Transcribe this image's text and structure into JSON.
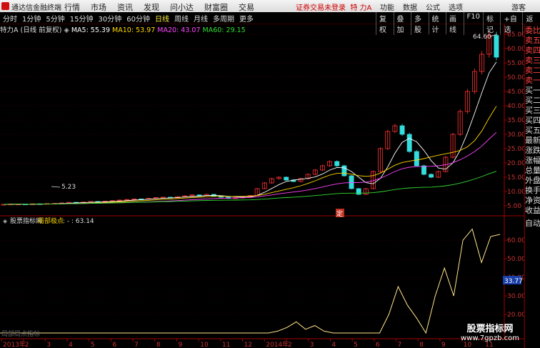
{
  "menubar": {
    "app_title": "通达信金融终端",
    "menus": [
      "行情",
      "市场",
      "资讯",
      "发现",
      "问小达",
      "财富圈",
      "交易"
    ],
    "notice": "证券交易未登录",
    "stock_name": "特 力A",
    "right_items": [
      "功能",
      "数据",
      "公式",
      "选项"
    ],
    "user": "游客",
    "accent": "#d01010"
  },
  "toolbar": {
    "periods": [
      "分时",
      "1分钟",
      "5分钟",
      "15分钟",
      "30分钟",
      "60分钟",
      "日线",
      "周线",
      "月线",
      "多周期",
      "更多"
    ],
    "active_period": "日线",
    "tools": [
      "复权",
      "叠加",
      "多股",
      "统计",
      "画线",
      "F10",
      "标记",
      "+自选",
      "返回"
    ]
  },
  "main_header": {
    "stock": "特力A",
    "mode": "(日线 前复权)",
    "ma5": "MA5: 55.39",
    "ma10": "MA10: 53.97",
    "ma20": "MA20: 43.07",
    "ma60": "MA60: 29.15",
    "colors": {
      "ma5": "#ffffff",
      "ma10": "#ffd700",
      "ma20": "#ff44ff",
      "ma60": "#33dd33"
    }
  },
  "price_axis": {
    "ticks": [
      "65.00",
      "60.00",
      "55.00",
      "50.00",
      "45.00",
      "40.00",
      "35.00",
      "30.00",
      "25.00",
      "20.00",
      "15.00",
      "10.00",
      "5.00"
    ]
  },
  "annotations": {
    "high": "64.60",
    "low": "5.23",
    "mark": "定"
  },
  "indicator": {
    "source": "股票指标网",
    "name": "局部极点",
    "value": ": - : 63.14",
    "axis": [
      "60.00",
      "50.00",
      "40.00",
      "30.00",
      "20.00"
    ],
    "current": "33.77",
    "footnote": "局部局点指标"
  },
  "time_axis": [
    "2013年",
    "2",
    "3",
    "4",
    "5",
    "6",
    "7",
    "8",
    "9",
    "10",
    "11",
    "12",
    "2014年",
    "2",
    "3",
    "4",
    "5",
    "6",
    "7",
    "8",
    "9",
    "10",
    "11"
  ],
  "right_panel": [
    "委比",
    "卖五",
    "卖四",
    "卖三",
    "卖二",
    "卖一",
    "买一",
    "买二",
    "买三",
    "买四",
    "买五",
    "最新",
    "涨跌",
    "涨幅",
    "总量",
    "外盘",
    "换手",
    "净资",
    "收益",
    "自动"
  ],
  "watermark": {
    "line1": "股票指标网",
    "line2": "www.7gpzb.com"
  },
  "chart_data": {
    "type": "candlestick",
    "ylim": [
      3,
      67
    ],
    "close_series": [
      5.5,
      5.6,
      5.6,
      5.4,
      5.7,
      5.6,
      5.8,
      5.9,
      6.0,
      6.2,
      6.1,
      6.3,
      6.5,
      6.4,
      6.6,
      6.8,
      7.0,
      7.2,
      7.4,
      7.3,
      7.6,
      7.9,
      8.0,
      7.8,
      8.2,
      8.5,
      8.8,
      8.6,
      9.0,
      8.4,
      8.0,
      7.6,
      7.8,
      8.2,
      8.6,
      11.0,
      13.0,
      14.5,
      15.0,
      14.0,
      13.5,
      14.5,
      16.0,
      17.5,
      19.0,
      20.5,
      19.0,
      15.5,
      11.0,
      9.0,
      11.0,
      17.0,
      25.0,
      31.0,
      33.0,
      30.0,
      24.0,
      19.0,
      16.0,
      15.0,
      17.0,
      22.0,
      30.0,
      38.0,
      45.0,
      52.0,
      58.0,
      64.6,
      57.0
    ],
    "ma_periods": [
      5,
      10,
      20,
      60
    ],
    "indicator_series": [
      3,
      3,
      3,
      4,
      4,
      4,
      4,
      5,
      5,
      5,
      5,
      6,
      6,
      6,
      5,
      5,
      6,
      6,
      6,
      6,
      7,
      7,
      7,
      7,
      7,
      8,
      8,
      8,
      9,
      10,
      11,
      13,
      16,
      12,
      14,
      11,
      10,
      9,
      8,
      7,
      6,
      3,
      20,
      35,
      25,
      18,
      5,
      30,
      45,
      30,
      60,
      66,
      48,
      62,
      63.14
    ]
  }
}
